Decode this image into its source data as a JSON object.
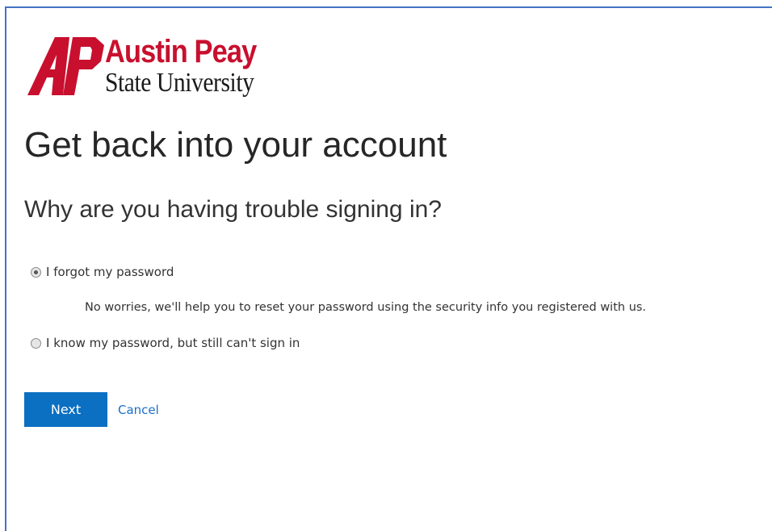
{
  "logo": {
    "line1": "Austin Peay",
    "line2": "State University",
    "brand_color": "#c8102e"
  },
  "page": {
    "title": "Get back into your account",
    "subtitle": "Why are you having trouble signing in?"
  },
  "options": [
    {
      "label": "I forgot my password",
      "description": "No worries, we'll help you to reset your password using the security info you registered with us.",
      "selected": true
    },
    {
      "label": "I know my password, but still can't sign in",
      "selected": false
    }
  ],
  "actions": {
    "next_label": "Next",
    "cancel_label": "Cancel",
    "primary_color": "#0b6fc2",
    "link_color": "#1a6fc9"
  }
}
